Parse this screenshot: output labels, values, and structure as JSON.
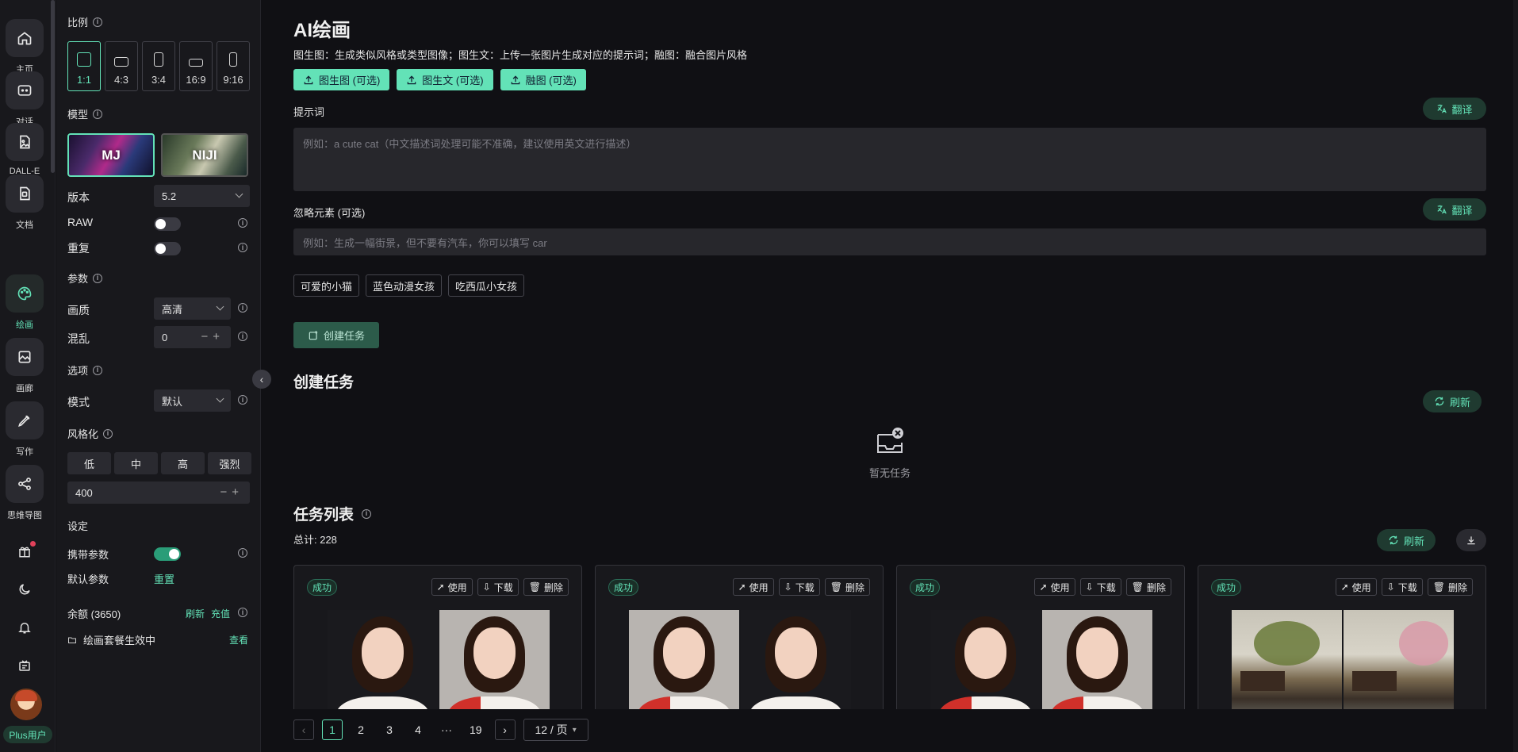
{
  "rail": {
    "items": [
      {
        "label": "主页",
        "icon": "home-icon"
      },
      {
        "label": "对话",
        "icon": "chat-icon"
      },
      {
        "label": "DALL-E",
        "icon": "image-file-icon"
      },
      {
        "label": "文档",
        "icon": "document-icon"
      },
      {
        "label": "绘画",
        "icon": "palette-icon",
        "active": true
      },
      {
        "label": "画廊",
        "icon": "gallery-icon"
      },
      {
        "label": "写作",
        "icon": "pen-icon"
      },
      {
        "label": "思维导图",
        "icon": "mindmap-icon"
      }
    ],
    "plus_label": "Plus用户"
  },
  "sidebar": {
    "ratio_title": "比例",
    "ratios": [
      "1:1",
      "4:3",
      "3:4",
      "16:9",
      "9:16"
    ],
    "model_title": "模型",
    "models": [
      "MJ",
      "NIJI"
    ],
    "version_label": "版本",
    "version_value": "5.2",
    "raw_label": "RAW",
    "repeat_label": "重复",
    "params_title": "参数",
    "quality_label": "画质",
    "quality_value": "高清",
    "chaos_label": "混乱",
    "chaos_value": "0",
    "options_title": "选项",
    "mode_label": "模式",
    "mode_value": "默认",
    "stylize_title": "风格化",
    "stylize_levels": [
      "低",
      "中",
      "高",
      "强烈"
    ],
    "stylize_value": "400",
    "settings_title": "设定",
    "carry_params_label": "携带参数",
    "default_params_label": "默认参数",
    "reset_label": "重置",
    "balance_label": "余额 (3650)",
    "refresh_label": "刷新",
    "recharge_label": "充值",
    "plan_label": "绘画套餐生效中",
    "view_label": "查看"
  },
  "main": {
    "title": "AI绘画",
    "subtitle": "图生图：生成类似风格或类型图像；图生文：上传一张图片生成对应的提示词；融图：融合图片风格",
    "uploads": [
      "图生图 (可选)",
      "图生文 (可选)",
      "融图 (可选)"
    ],
    "prompt_label": "提示词",
    "translate_label": "翻译",
    "prompt_placeholder": "例如：a cute cat（中文描述词处理可能不准确，建议使用英文进行描述）",
    "negative_label": "忽略元素 (可选)",
    "negative_placeholder": "例如：生成一幅街景，但不要有汽车，你可以填写 car",
    "tags": [
      "可爱的小猫",
      "蓝色动漫女孩",
      "吃西瓜小女孩"
    ],
    "create_label": "创建任务",
    "create_section_title": "创建任务",
    "refresh_label": "刷新",
    "empty_label": "暂无任务",
    "task_list_title": "任务列表",
    "total_label": "总计: 228",
    "cards": [
      {
        "status": "成功",
        "use": "使用",
        "download": "下载",
        "delete": "删除"
      },
      {
        "status": "成功",
        "use": "使用",
        "download": "下载",
        "delete": "删除"
      },
      {
        "status": "成功",
        "use": "使用",
        "download": "下载",
        "delete": "删除"
      },
      {
        "status": "成功",
        "use": "使用",
        "download": "下载",
        "delete": "删除"
      }
    ]
  },
  "pagination": {
    "pages": [
      "1",
      "2",
      "3",
      "4",
      "···",
      "19"
    ],
    "current": "1",
    "page_size": "12 / 页"
  },
  "colors": {
    "accent": "#63e2b7",
    "background": "#101014",
    "panel": "#18181c"
  }
}
